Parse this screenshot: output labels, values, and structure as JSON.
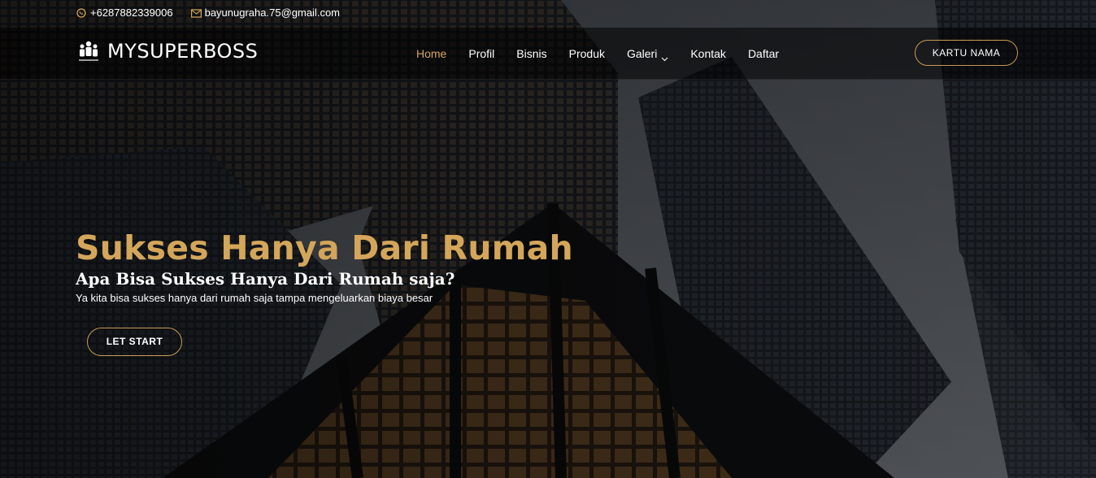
{
  "topbar": {
    "phone": "+6287882339006",
    "email": "bayunugraha.75@gmail.com"
  },
  "header": {
    "logo_text": "MYSUPERBOSS",
    "nav": [
      {
        "label": "Home",
        "active": true
      },
      {
        "label": "Profil"
      },
      {
        "label": "Bisnis"
      },
      {
        "label": "Produk"
      },
      {
        "label": "Galeri",
        "has_dropdown": true
      },
      {
        "label": "Kontak"
      },
      {
        "label": "Daftar"
      }
    ],
    "cta_label": "KARTU NAMA"
  },
  "hero": {
    "title": "Sukses Hanya Dari Rumah",
    "subtitle": "Apa Bisa Sukses Hanya Dari Rumah saja?",
    "text": "Ya kita bisa sukses hanya dari rumah saja tampa mengeluarkan biaya besar",
    "button_label": "LET START"
  },
  "colors": {
    "accent": "#d4a65a",
    "button_border": "#c89b53",
    "whatsapp_icon": "#d4a65a"
  },
  "icons": {
    "phone": "whatsapp-icon",
    "email": "envelope-icon",
    "logo": "people-group-icon",
    "dropdown": "chevron-down-icon"
  }
}
